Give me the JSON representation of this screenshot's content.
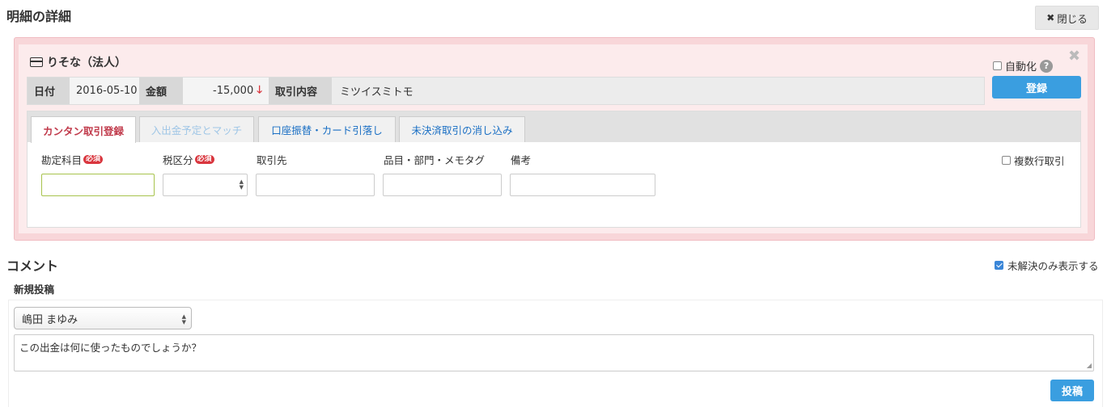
{
  "page": {
    "title": "明細の詳細",
    "close_label": "閉じる"
  },
  "detail": {
    "account_name": "りそな（法人）",
    "auto_label": "自動化",
    "register_label": "登録",
    "info": {
      "date_label": "日付",
      "date_value": "2016-05-10",
      "amount_label": "金額",
      "amount_value": "-15,000",
      "content_label": "取引内容",
      "content_value": "ミツイスミトモ"
    },
    "tabs": [
      {
        "label": "カンタン取引登録",
        "state": "active"
      },
      {
        "label": "入出金予定とマッチ",
        "state": "disabled"
      },
      {
        "label": "口座振替・カード引落し",
        "state": "link"
      },
      {
        "label": "未決済取引の消し込み",
        "state": "link"
      }
    ],
    "fields": {
      "account_item_label": "勘定科目",
      "tax_label": "税区分",
      "partner_label": "取引先",
      "item_label": "品目・部門・メモタグ",
      "note_label": "備考",
      "required_badge": "必須"
    },
    "multi_row_label": "複数行取引"
  },
  "comments": {
    "title": "コメント",
    "unresolved_label": "未解決のみ表示する",
    "new_post_label": "新規投稿",
    "selected_user": "嶋田 まゆみ",
    "comment_text": "この出金は何に使ったものでしょうか？",
    "post_label": "投稿"
  },
  "colors": {
    "accent": "#3a9ee0",
    "danger": "#d9363e",
    "panel_pink": "#fcebec"
  }
}
